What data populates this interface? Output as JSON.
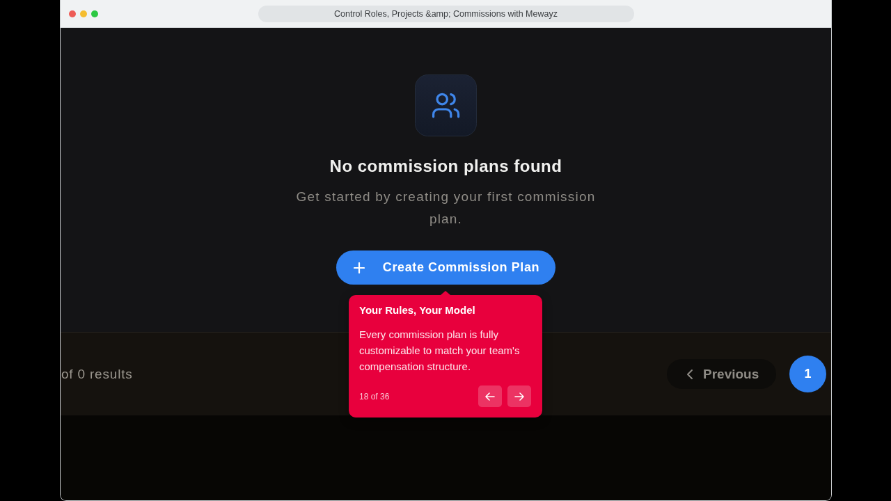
{
  "window": {
    "title": "Control Roles, Projects &amp; Commissions with Mewayz"
  },
  "empty_state": {
    "title": "No commission plans found",
    "description": "Get started by creating your first commission plan.",
    "button": {
      "label": "Create Commission Plan"
    }
  },
  "pagination": {
    "summary": "of 0 results",
    "previous": {
      "label": "Previous"
    },
    "pages": [
      {
        "label": "1",
        "selected": true
      }
    ]
  },
  "tour_tooltip": {
    "title": "Your Rules, Your Model",
    "body": "Every commission plan is fully customizable to match your team's compensation structure.",
    "step": "18 of 36"
  }
}
